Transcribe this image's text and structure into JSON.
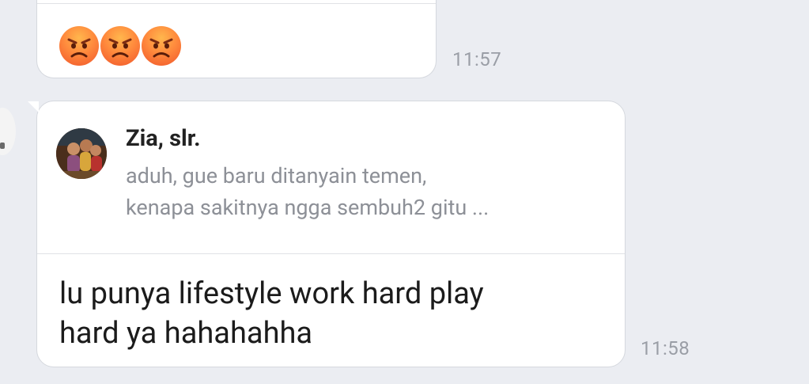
{
  "messages": [
    {
      "emojis": [
        "angry-face",
        "angry-face",
        "angry-face"
      ],
      "time": "11:57"
    },
    {
      "quote": {
        "name": "Zia, slr.",
        "text_line1": "aduh, gue baru ditanyain temen,",
        "text_line2": "kenapa sakitnya ngga sembuh2 gitu ..."
      },
      "text_line1": "lu punya lifestyle work hard play",
      "text_line2": "hard ya hahahahha",
      "time": "11:58"
    }
  ],
  "colors": {
    "background": "#ebedf2",
    "bubble": "#ffffff",
    "timestamp": "#9a9ea6",
    "quote_text": "#8d9097"
  }
}
